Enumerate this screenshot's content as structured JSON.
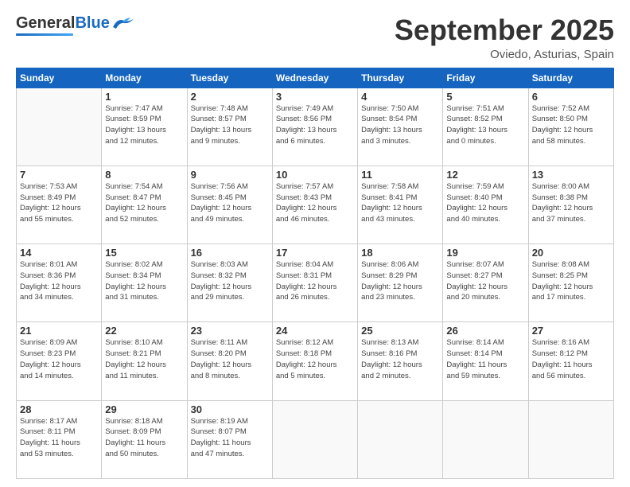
{
  "header": {
    "logo_general": "General",
    "logo_blue": "Blue",
    "month_title": "September 2025",
    "location": "Oviedo, Asturias, Spain"
  },
  "weekdays": [
    "Sunday",
    "Monday",
    "Tuesday",
    "Wednesday",
    "Thursday",
    "Friday",
    "Saturday"
  ],
  "weeks": [
    [
      {
        "day": "",
        "info": ""
      },
      {
        "day": "1",
        "info": "Sunrise: 7:47 AM\nSunset: 8:59 PM\nDaylight: 13 hours\nand 12 minutes."
      },
      {
        "day": "2",
        "info": "Sunrise: 7:48 AM\nSunset: 8:57 PM\nDaylight: 13 hours\nand 9 minutes."
      },
      {
        "day": "3",
        "info": "Sunrise: 7:49 AM\nSunset: 8:56 PM\nDaylight: 13 hours\nand 6 minutes."
      },
      {
        "day": "4",
        "info": "Sunrise: 7:50 AM\nSunset: 8:54 PM\nDaylight: 13 hours\nand 3 minutes."
      },
      {
        "day": "5",
        "info": "Sunrise: 7:51 AM\nSunset: 8:52 PM\nDaylight: 13 hours\nand 0 minutes."
      },
      {
        "day": "6",
        "info": "Sunrise: 7:52 AM\nSunset: 8:50 PM\nDaylight: 12 hours\nand 58 minutes."
      }
    ],
    [
      {
        "day": "7",
        "info": "Sunrise: 7:53 AM\nSunset: 8:49 PM\nDaylight: 12 hours\nand 55 minutes."
      },
      {
        "day": "8",
        "info": "Sunrise: 7:54 AM\nSunset: 8:47 PM\nDaylight: 12 hours\nand 52 minutes."
      },
      {
        "day": "9",
        "info": "Sunrise: 7:56 AM\nSunset: 8:45 PM\nDaylight: 12 hours\nand 49 minutes."
      },
      {
        "day": "10",
        "info": "Sunrise: 7:57 AM\nSunset: 8:43 PM\nDaylight: 12 hours\nand 46 minutes."
      },
      {
        "day": "11",
        "info": "Sunrise: 7:58 AM\nSunset: 8:41 PM\nDaylight: 12 hours\nand 43 minutes."
      },
      {
        "day": "12",
        "info": "Sunrise: 7:59 AM\nSunset: 8:40 PM\nDaylight: 12 hours\nand 40 minutes."
      },
      {
        "day": "13",
        "info": "Sunrise: 8:00 AM\nSunset: 8:38 PM\nDaylight: 12 hours\nand 37 minutes."
      }
    ],
    [
      {
        "day": "14",
        "info": "Sunrise: 8:01 AM\nSunset: 8:36 PM\nDaylight: 12 hours\nand 34 minutes."
      },
      {
        "day": "15",
        "info": "Sunrise: 8:02 AM\nSunset: 8:34 PM\nDaylight: 12 hours\nand 31 minutes."
      },
      {
        "day": "16",
        "info": "Sunrise: 8:03 AM\nSunset: 8:32 PM\nDaylight: 12 hours\nand 29 minutes."
      },
      {
        "day": "17",
        "info": "Sunrise: 8:04 AM\nSunset: 8:31 PM\nDaylight: 12 hours\nand 26 minutes."
      },
      {
        "day": "18",
        "info": "Sunrise: 8:06 AM\nSunset: 8:29 PM\nDaylight: 12 hours\nand 23 minutes."
      },
      {
        "day": "19",
        "info": "Sunrise: 8:07 AM\nSunset: 8:27 PM\nDaylight: 12 hours\nand 20 minutes."
      },
      {
        "day": "20",
        "info": "Sunrise: 8:08 AM\nSunset: 8:25 PM\nDaylight: 12 hours\nand 17 minutes."
      }
    ],
    [
      {
        "day": "21",
        "info": "Sunrise: 8:09 AM\nSunset: 8:23 PM\nDaylight: 12 hours\nand 14 minutes."
      },
      {
        "day": "22",
        "info": "Sunrise: 8:10 AM\nSunset: 8:21 PM\nDaylight: 12 hours\nand 11 minutes."
      },
      {
        "day": "23",
        "info": "Sunrise: 8:11 AM\nSunset: 8:20 PM\nDaylight: 12 hours\nand 8 minutes."
      },
      {
        "day": "24",
        "info": "Sunrise: 8:12 AM\nSunset: 8:18 PM\nDaylight: 12 hours\nand 5 minutes."
      },
      {
        "day": "25",
        "info": "Sunrise: 8:13 AM\nSunset: 8:16 PM\nDaylight: 12 hours\nand 2 minutes."
      },
      {
        "day": "26",
        "info": "Sunrise: 8:14 AM\nSunset: 8:14 PM\nDaylight: 11 hours\nand 59 minutes."
      },
      {
        "day": "27",
        "info": "Sunrise: 8:16 AM\nSunset: 8:12 PM\nDaylight: 11 hours\nand 56 minutes."
      }
    ],
    [
      {
        "day": "28",
        "info": "Sunrise: 8:17 AM\nSunset: 8:11 PM\nDaylight: 11 hours\nand 53 minutes."
      },
      {
        "day": "29",
        "info": "Sunrise: 8:18 AM\nSunset: 8:09 PM\nDaylight: 11 hours\nand 50 minutes."
      },
      {
        "day": "30",
        "info": "Sunrise: 8:19 AM\nSunset: 8:07 PM\nDaylight: 11 hours\nand 47 minutes."
      },
      {
        "day": "",
        "info": ""
      },
      {
        "day": "",
        "info": ""
      },
      {
        "day": "",
        "info": ""
      },
      {
        "day": "",
        "info": ""
      }
    ]
  ]
}
